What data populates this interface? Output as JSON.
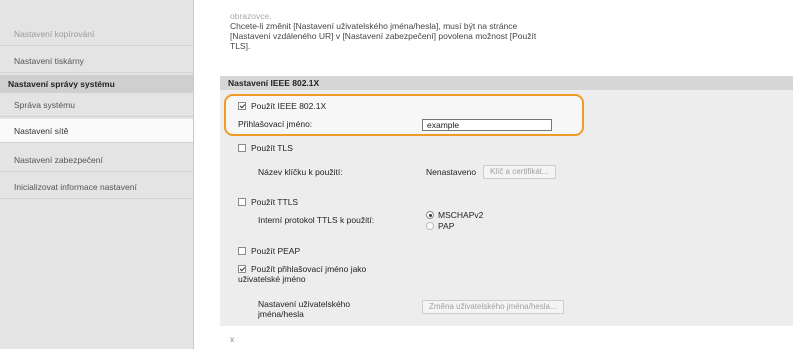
{
  "sidebar": {
    "items": [
      {
        "label": "Nastavení kopírování"
      },
      {
        "label": "Nastavení tiskárny"
      },
      {
        "label": "Správa systému"
      },
      {
        "label": "Nastavení sítě"
      },
      {
        "label": "Nastavení zabezpečení"
      },
      {
        "label": "Inicializovat informace nastavení"
      }
    ],
    "section_header": "Nastavení správy systému"
  },
  "notice": {
    "line1": "obrazovce.",
    "line2": "Chcete-li změnit [Nastavení uživatelského jména/hesla], musí být na stránce",
    "line3": "[Nastavení vzdáleného UR] v [Nastavení zabezpečení] povolena možnost [Použít",
    "line4": "TLS]."
  },
  "section_title": "Nastavení IEEE 802.1X",
  "form": {
    "use_ieee": {
      "label": "Použít IEEE 802.1X",
      "checked": true
    },
    "login_name": {
      "label": "Přihlašovací jméno:",
      "value": "example"
    },
    "use_tls": {
      "label": "Použít TLS",
      "checked": false
    },
    "key_label": "Název klíčku k použití:",
    "key_value": "Nenastaveno",
    "key_button": "Klíč a certifikát...",
    "use_ttls": {
      "label": "Použít TTLS",
      "checked": false
    },
    "ttls_protocol_label": "Interní protokol TTLS k použití:",
    "ttls_options": [
      {
        "label": "MSCHAPv2",
        "selected": true
      },
      {
        "label": "PAP",
        "selected": false
      }
    ],
    "use_peap": {
      "label": "Použít PEAP",
      "checked": false
    },
    "use_login_as_user": {
      "label_line1": "Použít přihlašovací jméno jako",
      "label_line2": "uživatelské jméno",
      "checked": true
    },
    "user_settings_label_line1": "Nastavení uživatelského",
    "user_settings_label_line2": "jména/hesla",
    "user_settings_button": "Změna uživatelského jména/hesla..."
  },
  "footer_mark": "x",
  "colors": {
    "highlight": "#f09a28"
  }
}
